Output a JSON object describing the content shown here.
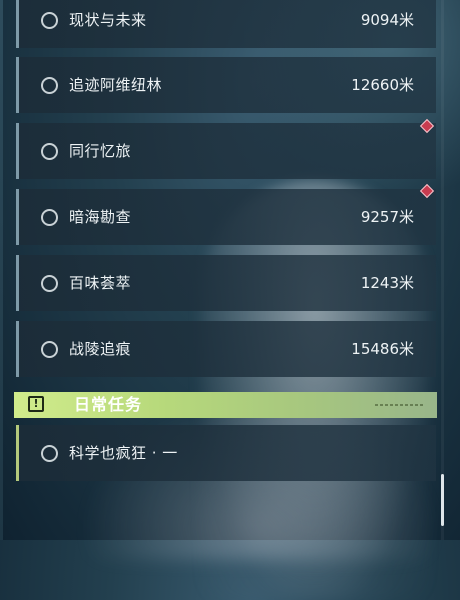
{
  "quests": [
    {
      "name": "现状与未来",
      "distance": "9094米"
    },
    {
      "name": "追迹阿维纽林",
      "distance": "12660米"
    },
    {
      "name": "同行忆旅",
      "distance": ""
    },
    {
      "name": "暗海勘查",
      "distance": "9257米"
    },
    {
      "name": "百味荟萃",
      "distance": "1243米"
    },
    {
      "name": "战陵追痕",
      "distance": "15486米"
    }
  ],
  "daily": {
    "title": "日常任务",
    "icon": "exclamation-icon",
    "icon_glyph": "!",
    "quests": [
      {
        "name": "科学也疯狂 · 一",
        "distance": ""
      }
    ]
  },
  "colors": {
    "daily_accent": "#c6e48a",
    "marker": "#c83c50"
  },
  "icons": [
    "quest-status-circle-icon",
    "map-marker-diamond-icon"
  ]
}
